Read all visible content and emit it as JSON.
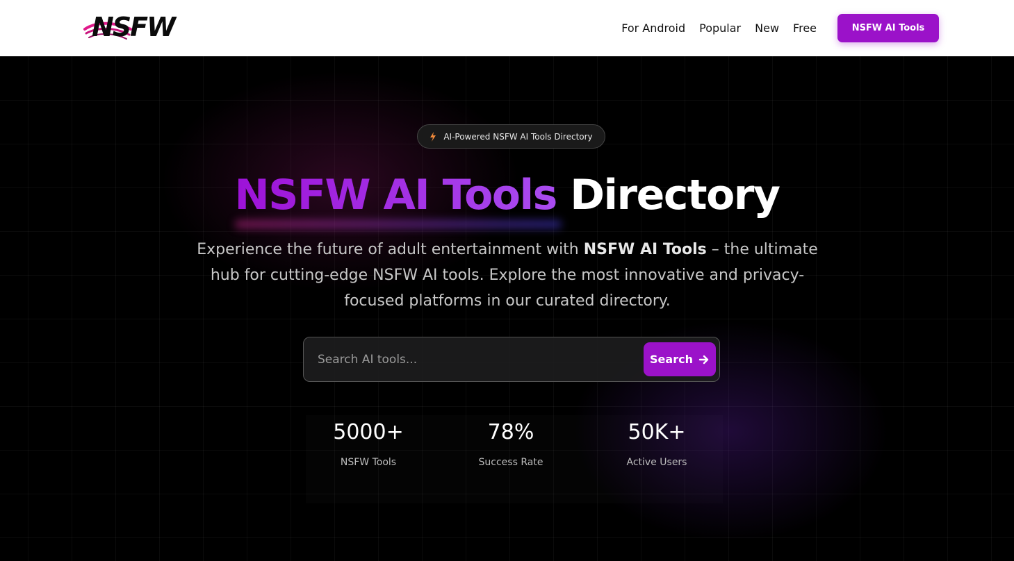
{
  "header": {
    "logo_text": "NSFW",
    "nav": [
      {
        "label": "For Android"
      },
      {
        "label": "Popular"
      },
      {
        "label": "New"
      },
      {
        "label": "Free"
      }
    ],
    "cta_label": "NSFW AI Tools"
  },
  "hero": {
    "badge_text": "AI-Powered NSFW AI Tools Directory",
    "title_accent": "NSFW AI Tools",
    "title_rest": "Directory",
    "description_before": "Experience the future of adult entertainment with ",
    "description_bold": "NSFW AI Tools",
    "description_after": " – the ultimate hub for cutting-edge NSFW AI tools. Explore the most innovative and privacy-focused platforms in our curated directory.",
    "search": {
      "placeholder": "Search AI tools...",
      "button_label": "Search"
    },
    "stats": [
      {
        "value": "5000+",
        "label": "NSFW Tools"
      },
      {
        "value": "78%",
        "label": "Success Rate"
      },
      {
        "value": "50K+",
        "label": "Active Users"
      }
    ]
  },
  "colors": {
    "accent": "#9b12c9",
    "background": "#000000",
    "header_bg": "#ffffff"
  },
  "icons": {
    "badge_icon": "lightning-bolt-icon",
    "search_button_icon": "arrow-right-icon",
    "logo_swoosh": "pink-swoosh-icon"
  }
}
